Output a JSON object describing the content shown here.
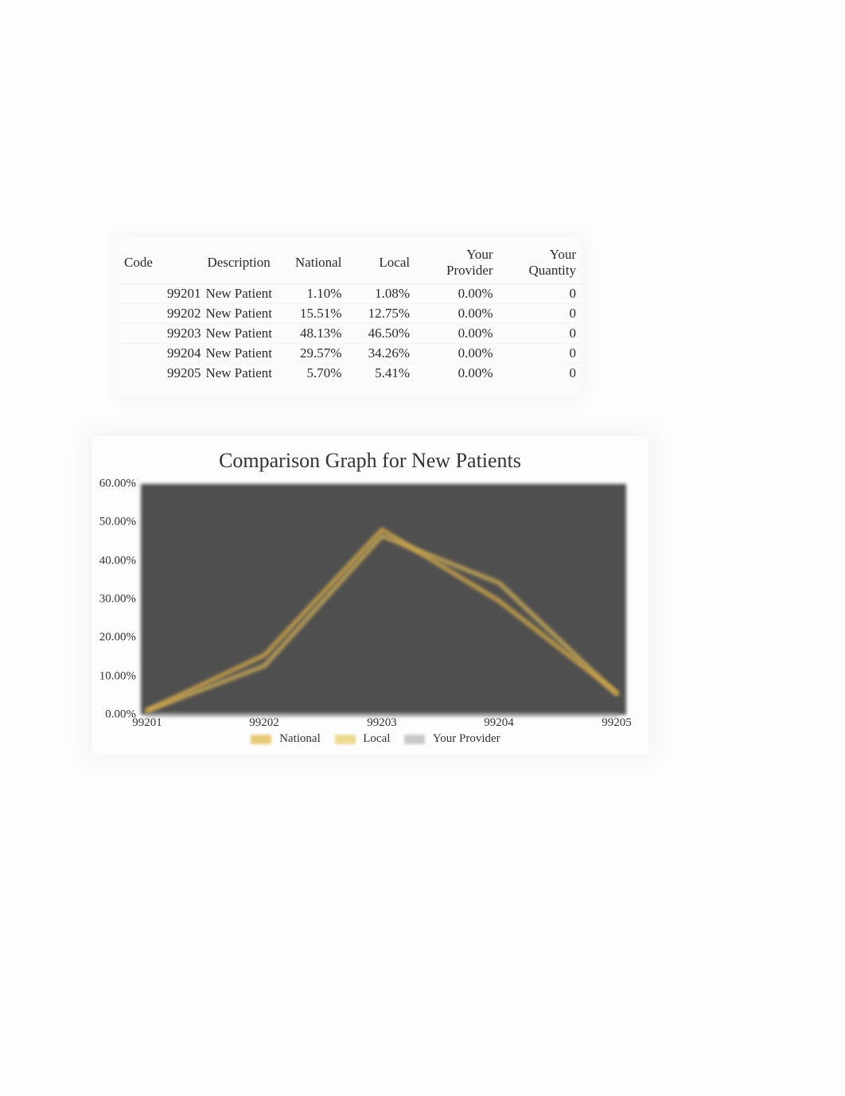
{
  "table": {
    "headers": {
      "code": "Code",
      "description": "Description",
      "national": "National",
      "local": "Local",
      "provider": "Your Provider",
      "quantity": "Your Quantity"
    },
    "rows": [
      {
        "code": "99201",
        "description": "New Patient",
        "national": "1.10%",
        "local": "1.08%",
        "provider": "0.00%",
        "quantity": "0"
      },
      {
        "code": "99202",
        "description": "New Patient",
        "national": "15.51%",
        "local": "12.75%",
        "provider": "0.00%",
        "quantity": "0"
      },
      {
        "code": "99203",
        "description": "New Patient",
        "national": "48.13%",
        "local": "46.50%",
        "provider": "0.00%",
        "quantity": "0"
      },
      {
        "code": "99204",
        "description": "New Patient",
        "national": "29.57%",
        "local": "34.26%",
        "provider": "0.00%",
        "quantity": "0"
      },
      {
        "code": "99205",
        "description": "New Patient",
        "national": "5.70%",
        "local": "5.41%",
        "provider": "0.00%",
        "quantity": "0"
      }
    ]
  },
  "chart_data": {
    "type": "line",
    "title": "Comparison Graph for New Patients",
    "xlabel": "",
    "ylabel": "",
    "categories": [
      "99201",
      "99202",
      "99203",
      "99204",
      "99205"
    ],
    "y_ticks": [
      "0.00%",
      "10.00%",
      "20.00%",
      "30.00%",
      "40.00%",
      "50.00%",
      "60.00%"
    ],
    "ylim": [
      0,
      60
    ],
    "series": [
      {
        "name": "National",
        "values": [
          1.1,
          15.51,
          48.13,
          29.57,
          5.7
        ]
      },
      {
        "name": "Local",
        "values": [
          1.08,
          12.75,
          46.5,
          34.26,
          5.41
        ]
      },
      {
        "name": "Your Provider",
        "values": [
          0.0,
          0.0,
          0.0,
          0.0,
          0.0
        ]
      }
    ],
    "legend_position": "bottom"
  },
  "legend_labels": {
    "national": "National",
    "local": "Local",
    "provider": "Your Provider"
  }
}
